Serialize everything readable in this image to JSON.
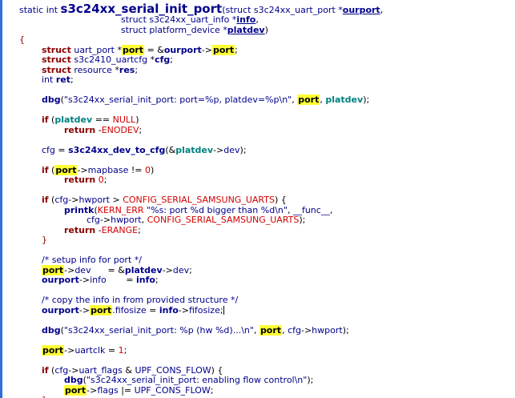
{
  "signature": {
    "prefix": "static int ",
    "fn_name": "s3c24xx_serial_init_port",
    "args1": "(struct s3c24xx_uart_port *",
    "ourport": "ourport",
    "comma1": ",",
    "args2": "struct s3c24xx_uart_info *",
    "info": "info",
    "comma2": ",",
    "args3": "struct platform_device *",
    "platdev": "platdev",
    "close": ")"
  },
  "lines": [
    "{",
    "struct uart_port *port = &ourport->port;",
    "struct s3c2410_uartcfg *cfg;",
    "struct resource *res;",
    "int ret;",
    "",
    "dbg(\"s3c24xx_serial_init_port: port=%p, platdev=%p\\n\", port, platdev);",
    "",
    "if (platdev == NULL)",
    "return -ENODEV;",
    "",
    "cfg = s3c24xx_dev_to_cfg(&platdev->dev);",
    "",
    "if (port->mapbase != 0)",
    "return 0;",
    "",
    "if (cfg->hwport > CONFIG_SERIAL_SAMSUNG_UARTS) {",
    "printk(KERN_ERR \"%s: port %d bigger than %d\\n\", __func__,",
    "cfg->hwport, CONFIG_SERIAL_SAMSUNG_UARTS);",
    "return -ERANGE;",
    "}",
    "",
    "/* setup info for port */",
    "port->dev = &platdev->dev;",
    "ourport->info = info;",
    "",
    "/* copy the info in from provided structure */",
    "ourport->port.fifosize = info->fifosize;",
    "",
    "dbg(\"s3c24xx_serial_init_port: %p (hw %d)...\\n\", port, cfg->hwport);",
    "",
    "port->uartclk = 1;",
    "",
    "if (cfg->uart_flags & UPF_CONS_FLOW) {",
    "dbg(\"s3c24xx_serial_init_port: enabling flow control\\n\");",
    "port->flags |= UPF_CONS_FLOW;",
    "}"
  ]
}
